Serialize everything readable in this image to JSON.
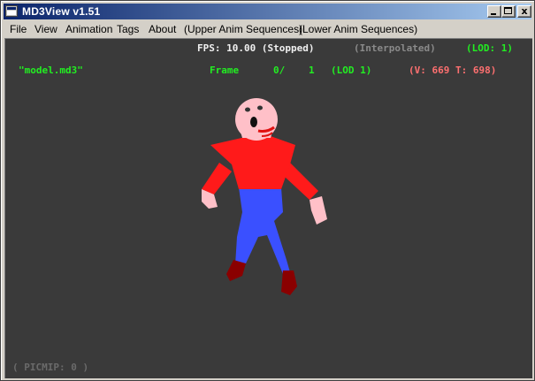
{
  "window": {
    "title": "MD3View v1.51",
    "controls": {
      "minimize": "",
      "maximize": "",
      "close": "x"
    }
  },
  "menu": {
    "items": [
      "File",
      "View",
      "Animation",
      "Tags",
      "About",
      "(Upper Anim Sequences)",
      "(Lower Anim Sequences)"
    ]
  },
  "hud": {
    "fps": "FPS: 10.00 (Stopped)",
    "interpolated": "(Interpolated)",
    "lod_top": "(LOD: 1)",
    "model_name": "\"model.md3\"",
    "frame_label": "Frame",
    "frame_current": "0/",
    "frame_total": "1",
    "lod_frame": "(LOD 1)",
    "vt_info": "(V: 669 T: 698)",
    "picmip": "( PICMIP: 0 )"
  },
  "colors": {
    "viewport_bg": "#3a3a3a",
    "hud_white": "#f0f0f0",
    "hud_gray": "#8a8a8a",
    "hud_green": "#22ee22",
    "hud_red": "#ff7070",
    "hud_dim": "#6a6a6a",
    "shirt": "#ff1a1a",
    "pants": "#3a50ff",
    "skin": "#ffc0c8",
    "boots": "#8a0000"
  }
}
